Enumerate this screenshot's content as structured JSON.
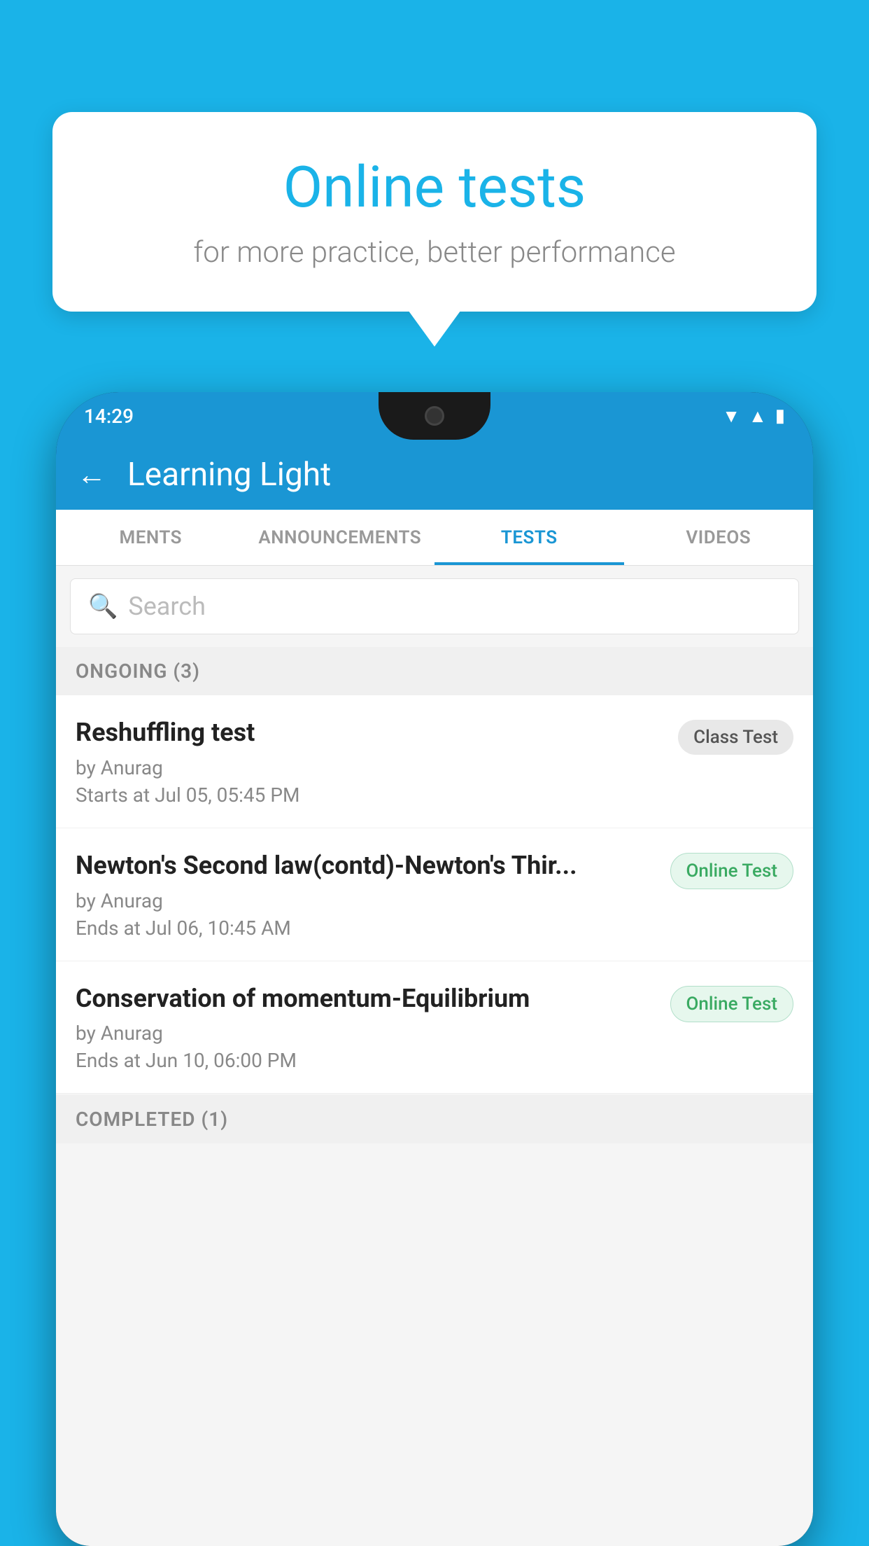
{
  "background": {
    "color": "#1ab3e8"
  },
  "speech_bubble": {
    "title": "Online tests",
    "subtitle": "for more practice, better performance"
  },
  "phone": {
    "status_bar": {
      "time": "14:29",
      "icons": [
        "wifi",
        "signal",
        "battery"
      ]
    },
    "app_header": {
      "back_label": "←",
      "title": "Learning Light"
    },
    "tabs": [
      {
        "label": "MENTS",
        "active": false
      },
      {
        "label": "ANNOUNCEMENTS",
        "active": false
      },
      {
        "label": "TESTS",
        "active": true
      },
      {
        "label": "VIDEOS",
        "active": false
      }
    ],
    "search": {
      "placeholder": "Search"
    },
    "ongoing_section": {
      "label": "ONGOING (3)"
    },
    "tests": [
      {
        "title": "Reshuffling test",
        "author": "by Anurag",
        "time_label": "Starts at  Jul 05, 05:45 PM",
        "badge": "Class Test",
        "badge_type": "class"
      },
      {
        "title": "Newton's Second law(contd)-Newton's Thir...",
        "author": "by Anurag",
        "time_label": "Ends at  Jul 06, 10:45 AM",
        "badge": "Online Test",
        "badge_type": "online"
      },
      {
        "title": "Conservation of momentum-Equilibrium",
        "author": "by Anurag",
        "time_label": "Ends at  Jun 10, 06:00 PM",
        "badge": "Online Test",
        "badge_type": "online"
      }
    ],
    "completed_section": {
      "label": "COMPLETED (1)"
    }
  }
}
